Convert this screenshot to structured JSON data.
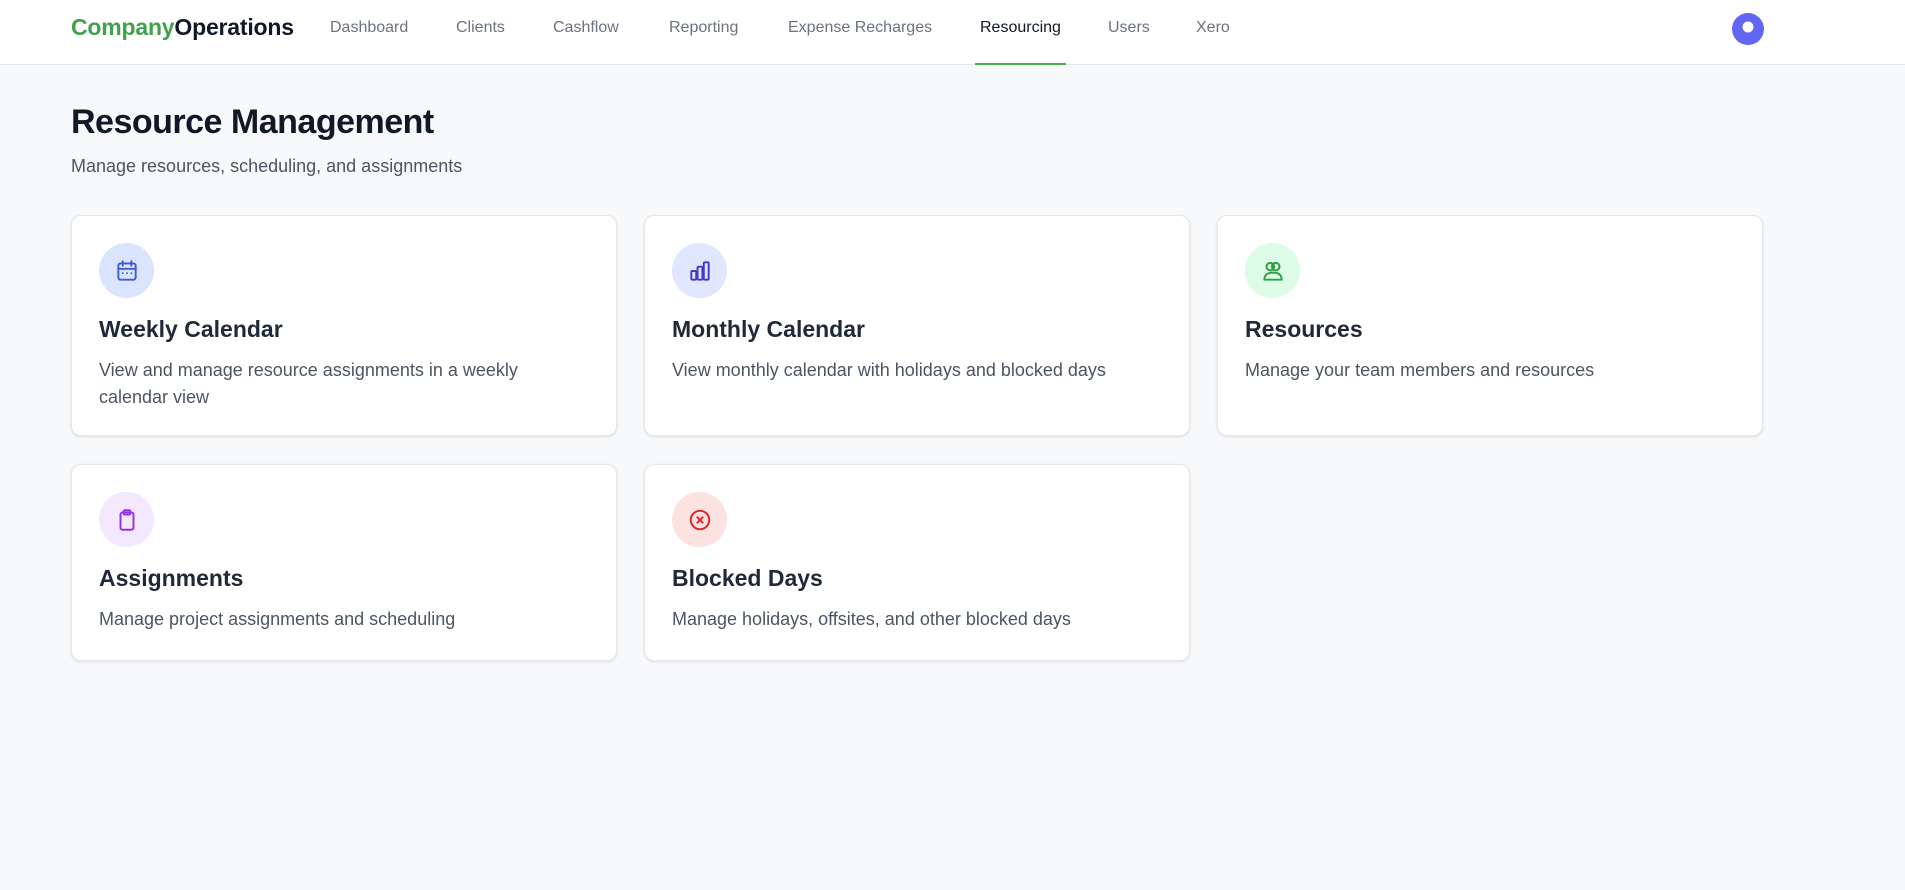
{
  "brand": {
    "part1": "Company",
    "part2": "Operations"
  },
  "nav": [
    {
      "label": "Dashboard"
    },
    {
      "label": "Clients"
    },
    {
      "label": "Cashflow"
    },
    {
      "label": "Reporting"
    },
    {
      "label": "Expense Recharges"
    },
    {
      "label": "Resourcing",
      "active": true
    },
    {
      "label": "Users"
    },
    {
      "label": "Xero"
    }
  ],
  "page": {
    "title": "Resource Management",
    "subtitle": "Manage resources, scheduling, and assignments"
  },
  "cards": [
    {
      "title": "Weekly Calendar",
      "description": "View and manage resource assignments in a weekly calendar view",
      "icon": "calendar-icon",
      "icon_color": "#3b5bdb",
      "icon_bg": "#dbe4ff"
    },
    {
      "title": "Monthly Calendar",
      "description": "View monthly calendar with holidays and blocked days",
      "icon": "bar-chart-icon",
      "icon_color": "#4338ca",
      "icon_bg": "#e0e7ff"
    },
    {
      "title": "Resources",
      "description": "Manage your team members and resources",
      "icon": "users-icon",
      "icon_color": "#2f9e44",
      "icon_bg": "#dcfce7"
    },
    {
      "title": "Assignments",
      "description": "Manage project assignments and scheduling",
      "icon": "clipboard-icon",
      "icon_color": "#9333ea",
      "icon_bg": "#f3e8ff"
    },
    {
      "title": "Blocked Days",
      "description": "Manage holidays, offsites, and other blocked days",
      "icon": "x-circle-icon",
      "icon_color": "#dc2626",
      "icon_bg": "#fde2e2"
    }
  ],
  "colors": {
    "accent": "#4caf50",
    "avatar": "#6366f1"
  }
}
